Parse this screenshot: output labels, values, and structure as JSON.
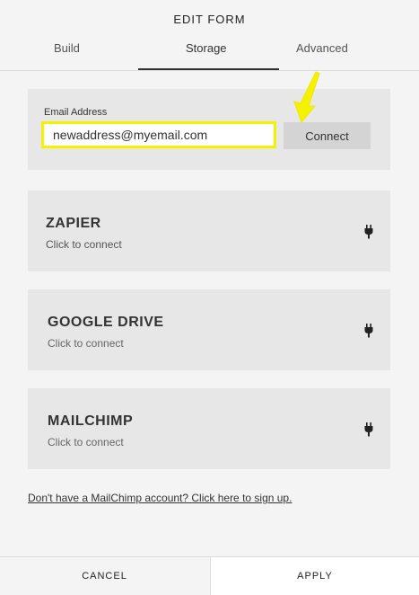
{
  "header": {
    "title": "EDIT FORM",
    "tabs": [
      {
        "label": "Build"
      },
      {
        "label": "Storage",
        "active": true
      },
      {
        "label": "Advanced"
      }
    ]
  },
  "email_panel": {
    "label": "Email Address",
    "value": "newaddress@myemail.com",
    "connect_label": "Connect"
  },
  "services": [
    {
      "name": "ZAPIER",
      "subtitle": "Click to connect",
      "icon": "plug-icon"
    },
    {
      "name": "GOOGLE DRIVE",
      "subtitle": "Click to connect",
      "icon": "plug-icon"
    },
    {
      "name": "MAILCHIMP",
      "subtitle": "Click to connect",
      "icon": "plug-icon"
    }
  ],
  "signup_link": "Don't have a MailChimp account? Click here to sign up.",
  "footer": {
    "cancel_label": "CANCEL",
    "apply_label": "APPLY"
  },
  "colors": {
    "highlight": "#f5f200",
    "panel": "#e7e7e7",
    "background": "#f4f4f4"
  }
}
